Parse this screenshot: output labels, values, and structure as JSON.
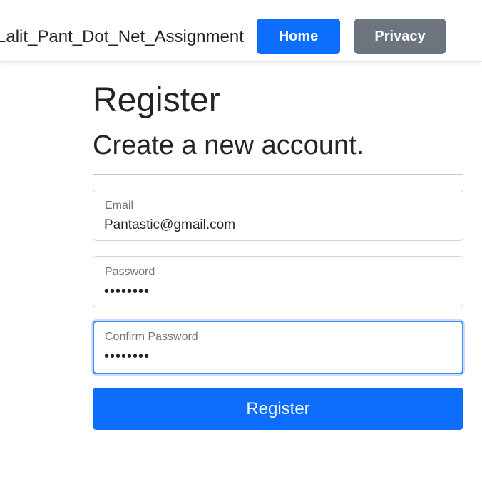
{
  "navbar": {
    "brand": "Lalit_Pant_Dot_Net_Assignment",
    "home_label": "Home",
    "privacy_label": "Privacy"
  },
  "page": {
    "title": "Register",
    "subtitle": "Create a new account."
  },
  "form": {
    "email": {
      "label": "Email",
      "value": "Pantastic@gmail.com"
    },
    "password": {
      "label": "Password",
      "value": "••••••••"
    },
    "confirm_password": {
      "label": "Confirm Password",
      "value": "••••••••",
      "focused": true
    },
    "submit_label": "Register"
  },
  "colors": {
    "primary": "#0d6efd",
    "secondary": "#6c757d",
    "text": "#212529",
    "focus_border": "#3d8bfd"
  }
}
